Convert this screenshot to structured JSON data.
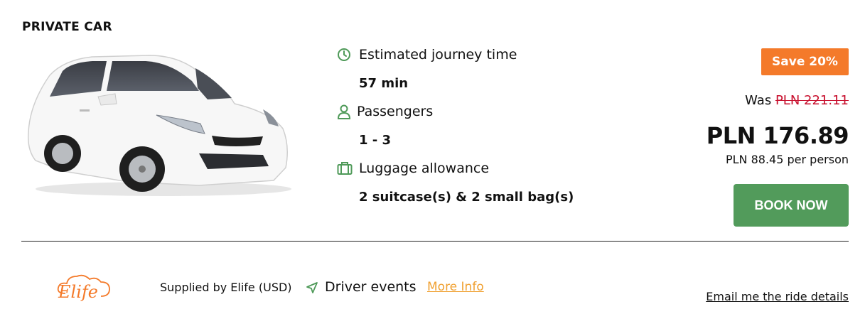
{
  "listing": {
    "title": "PRIVATE CAR"
  },
  "details": {
    "journey_label": "Estimated journey time",
    "journey_value": "57 min",
    "passengers_label": "Passengers",
    "passengers_value": "1 - 3",
    "luggage_label": "Luggage allowance",
    "luggage_value": "2 suitcase(s) & 2 small bag(s)"
  },
  "pricing": {
    "save_badge": "Save 20%",
    "was_label": "Was",
    "was_price": "PLN 221.11",
    "price": "PLN 176.89",
    "per_person": "PLN 88.45 per person",
    "book_label": "BOOK NOW"
  },
  "footer": {
    "supplier_logo_text": "Elife",
    "supplier_text": "Supplied by Elife (USD)",
    "driver_events": "Driver events",
    "more_info": "More Info",
    "email_link": "Email me the ride details"
  },
  "colors": {
    "accent_green": "#529b5b",
    "badge_orange": "#f47a2a",
    "old_price_red": "#c8102e",
    "link_orange": "#f0a030"
  },
  "icons": {
    "journey": "clock-icon",
    "passengers": "person-icon",
    "luggage": "luggage-icon",
    "driver_events": "navigation-arrow-icon"
  }
}
